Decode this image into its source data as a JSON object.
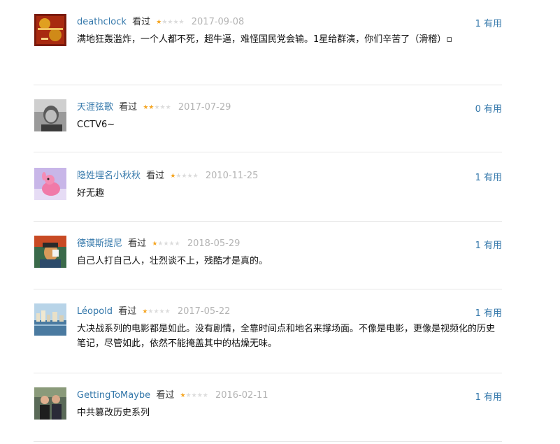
{
  "comments": [
    {
      "user": "deathclock",
      "status": "看过",
      "rating": 1,
      "date": "2017-09-08",
      "votes": "1 有用",
      "text": "满地狂轰滥炸，一个人都不死，超牛逼，难怪国民党会输。1星给群演，你们辛苦了（滑稽）▫"
    },
    {
      "user": "天涯弦歌",
      "status": "看过",
      "rating": 2,
      "date": "2017-07-29",
      "votes": "0 有用",
      "text": "CCTV6~"
    },
    {
      "user": "隐姓埋名小秋秋",
      "status": "看过",
      "rating": 1,
      "date": "2010-11-25",
      "votes": "1 有用",
      "text": "好无趣"
    },
    {
      "user": "德谟斯提尼",
      "status": "看过",
      "rating": 1,
      "date": "2018-05-29",
      "votes": "1 有用",
      "text": "自己人打自己人，壮烈谈不上，残酷才是真的。"
    },
    {
      "user": "Léopold",
      "status": "看过",
      "rating": 1,
      "date": "2017-05-22",
      "votes": "1 有用",
      "text": "大决战系列的电影都是如此。没有剧情，全靠时间点和地名来撑场面。不像是电影，更像是视频化的历史笔记，尽管如此，依然不能掩盖其中的枯燥无味。"
    },
    {
      "user": "GettingToMaybe",
      "status": "看过",
      "rating": 1,
      "date": "2016-02-11",
      "votes": "1 有用",
      "text": "中共篡改历史系列"
    }
  ],
  "avatar_icons": [
    "poster-avatar-icon",
    "portrait-avatar-icon",
    "pink-toy-avatar-icon",
    "painting-avatar-icon",
    "city-skyline-avatar-icon",
    "couple-avatar-icon"
  ],
  "colors": {
    "link": "#3377aa",
    "star_on": "#f5a623",
    "star_off": "#dcdcdc",
    "date": "#b4b4b4",
    "divider": "#e7e7e7"
  }
}
